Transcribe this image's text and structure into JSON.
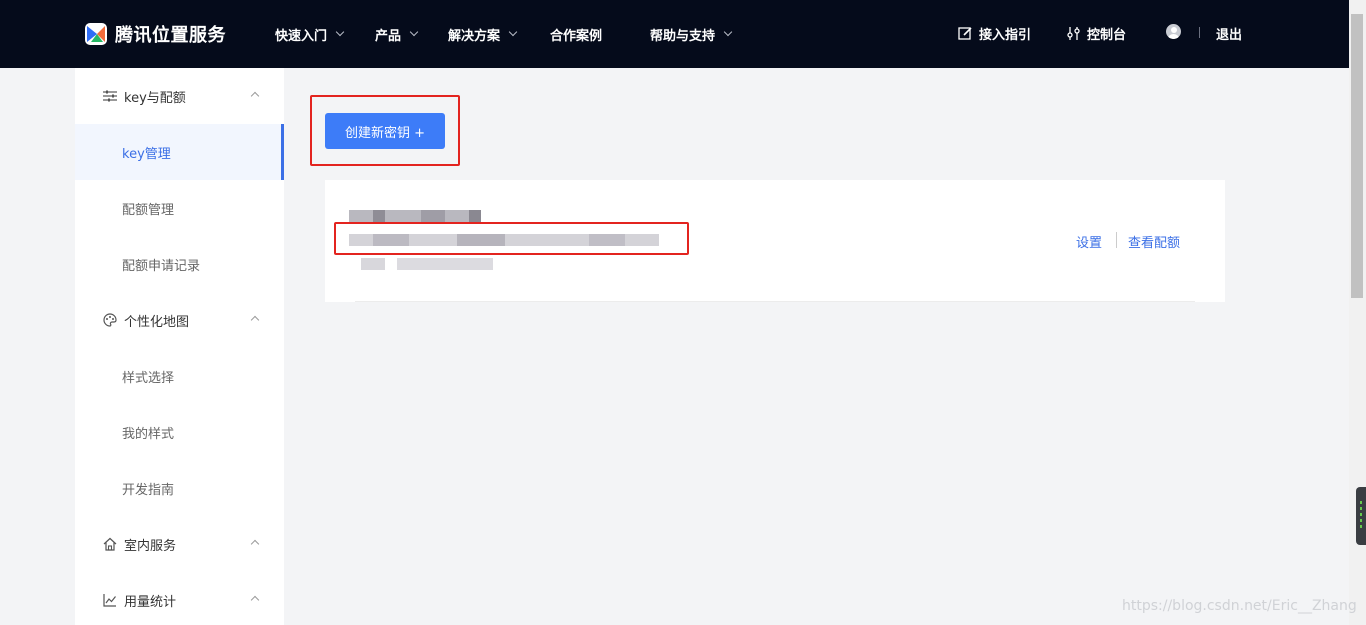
{
  "brand": {
    "name": "腾讯位置服务",
    "logo_icon": "tencent-location-logo"
  },
  "nav": {
    "items": [
      {
        "label": "快速入门",
        "has_dropdown": true
      },
      {
        "label": "产品",
        "has_dropdown": true
      },
      {
        "label": "解决方案",
        "has_dropdown": true
      },
      {
        "label": "合作案例",
        "has_dropdown": false
      },
      {
        "label": "帮助与支持",
        "has_dropdown": true
      }
    ],
    "guide_label": "接入指引",
    "console_label": "控制台",
    "logout_label": "退出"
  },
  "sidebar": {
    "groups": [
      {
        "label": "key与配额",
        "icon": "sliders-icon",
        "expanded": true,
        "items": [
          "key管理",
          "配额管理",
          "配额申请记录"
        ],
        "active_item": "key管理"
      },
      {
        "label": "个性化地图",
        "icon": "palette-icon",
        "expanded": true,
        "items": [
          "样式选择",
          "我的样式",
          "开发指南"
        ]
      },
      {
        "label": "室内服务",
        "icon": "home-icon",
        "expanded": true,
        "items": []
      },
      {
        "label": "用量统计",
        "icon": "chart-icon",
        "expanded": true,
        "items": []
      }
    ]
  },
  "main": {
    "create_button_label": "创建新密钥 +",
    "key_card": {
      "actions": {
        "settings": "设置",
        "view_quota": "查看配额"
      },
      "content_redacted": true
    }
  },
  "highlight_color": "#e3241f",
  "accent_color": "#3d7cf8",
  "watermark": "https://blog.csdn.net/Eric__Zhang"
}
